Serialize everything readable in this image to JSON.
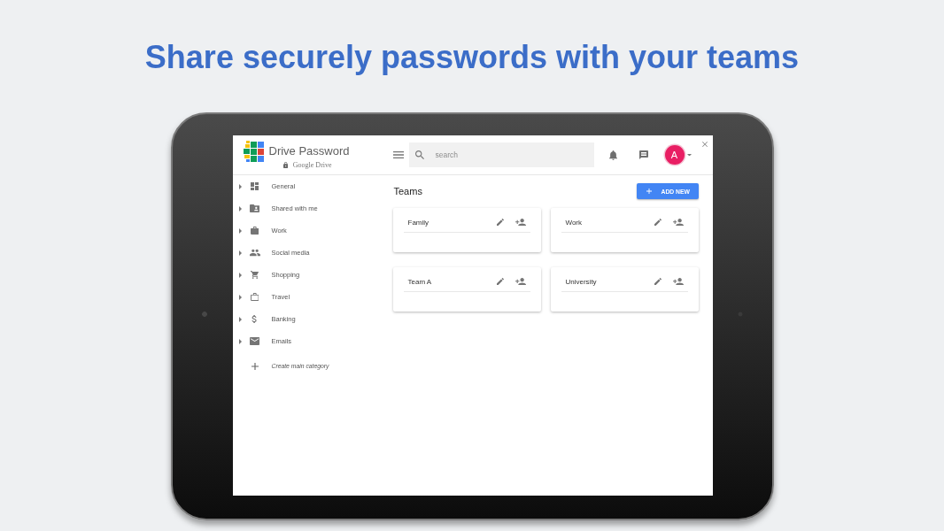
{
  "headline": "Share securely passwords with your teams",
  "app": {
    "logo": {
      "title": "Drive Password",
      "subtitle": "Google Drive"
    },
    "search": {
      "placeholder": "search"
    },
    "account": {
      "initial": "A"
    },
    "sidebar": {
      "items": [
        {
          "label": "General",
          "expanded": false
        },
        {
          "label": "Shared with me",
          "expanded": false
        },
        {
          "label": "Work",
          "expanded": false
        },
        {
          "label": "Social media",
          "expanded": false
        },
        {
          "label": "Shopping",
          "expanded": false
        },
        {
          "label": "Travel",
          "expanded": false
        },
        {
          "label": "Banking",
          "expanded": false
        },
        {
          "label": "Emails",
          "expanded": false
        }
      ],
      "create_label": "Create main category"
    },
    "page_title": "Teams",
    "add_button": "ADD NEW",
    "teams": [
      {
        "name": "Family"
      },
      {
        "name": "Work"
      },
      {
        "name": "Team A"
      },
      {
        "name": "University"
      }
    ]
  }
}
